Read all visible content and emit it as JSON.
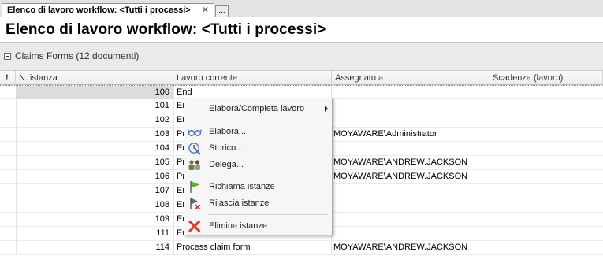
{
  "tab": {
    "label": "Elenco di lavoro workflow: <Tutti i processi>",
    "close": "✕",
    "more": "..."
  },
  "page_title": "Elenco di lavoro workflow: <Tutti i processi>",
  "group": {
    "label": "Claims Forms (12 documenti)"
  },
  "columns": {
    "flag": "!",
    "instance": "N. istanza",
    "work": "Lavoro corrente",
    "assigned": "Assegnato a",
    "due": "Scadenza (lavoro)"
  },
  "rows": [
    {
      "instance": "100",
      "work": "End",
      "assigned": "",
      "due": ""
    },
    {
      "instance": "101",
      "work": "En",
      "assigned": "",
      "due": ""
    },
    {
      "instance": "102",
      "work": "En",
      "assigned": "",
      "due": ""
    },
    {
      "instance": "103",
      "work": "Pr",
      "assigned": "MOYAWARE\\Administrator",
      "due": ""
    },
    {
      "instance": "104",
      "work": "En",
      "assigned": "",
      "due": ""
    },
    {
      "instance": "105",
      "work": "Pr",
      "assigned": "MOYAWARE\\ANDREW.JACKSON",
      "due": ""
    },
    {
      "instance": "106",
      "work": "Pr",
      "assigned": "MOYAWARE\\ANDREW.JACKSON",
      "due": ""
    },
    {
      "instance": "107",
      "work": "En",
      "assigned": "",
      "due": ""
    },
    {
      "instance": "108",
      "work": "En",
      "assigned": "",
      "due": ""
    },
    {
      "instance": "109",
      "work": "En",
      "assigned": "",
      "due": ""
    },
    {
      "instance": "111",
      "work": "End",
      "assigned": "",
      "due": ""
    },
    {
      "instance": "114",
      "work": "Process claim form",
      "assigned": "MOYAWARE\\ANDREW.JACKSON",
      "due": ""
    }
  ],
  "context_menu": {
    "items": [
      {
        "label": "Elabora/Completa lavoro",
        "icon": "none",
        "submenu": true
      },
      {
        "label": "Elabora...",
        "icon": "glasses-icon"
      },
      {
        "label": "Storico...",
        "icon": "history-clock-icon"
      },
      {
        "label": "Delega...",
        "icon": "delegate-users-icon"
      },
      {
        "label": "Richiama istanze",
        "icon": "green-flag-icon"
      },
      {
        "label": "Rilascia istanze",
        "icon": "flag-release-icon"
      },
      {
        "label": "Elimina istanze",
        "icon": "red-x-icon"
      }
    ]
  },
  "colors": {
    "delete_red": "#e0402f",
    "flag_green": "#5cb82e",
    "icon_blue": "#3a6fc4"
  }
}
